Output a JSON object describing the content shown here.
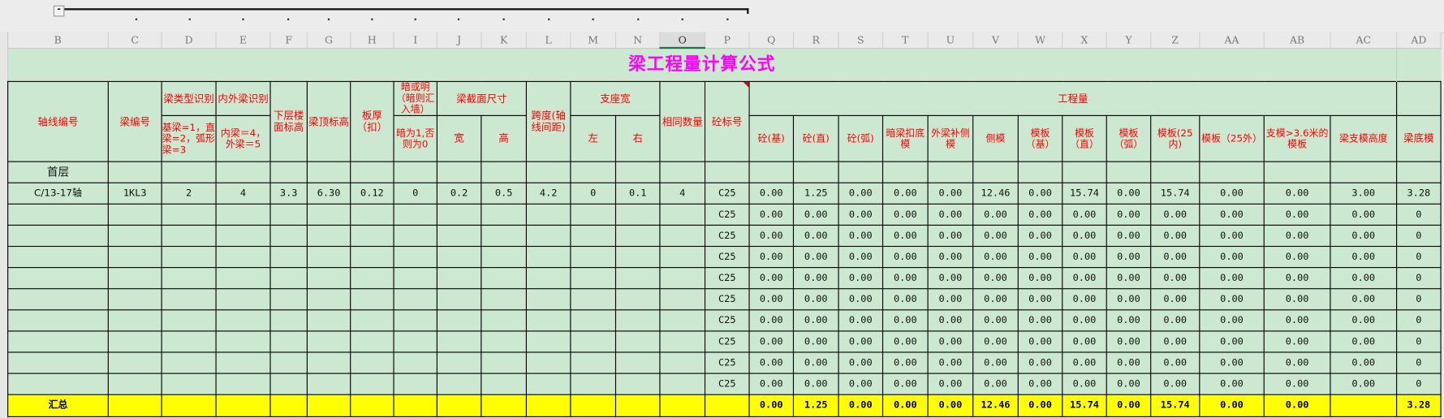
{
  "columns": [
    "B",
    "C",
    "D",
    "E",
    "F",
    "G",
    "H",
    "I",
    "J",
    "K",
    "L",
    "M",
    "N",
    "O",
    "P",
    "Q",
    "R",
    "S",
    "T",
    "U",
    "V",
    "W",
    "X",
    "Y",
    "Z",
    "AA",
    "AB",
    "AC",
    "AD"
  ],
  "selected_column": "O",
  "title": "梁工程量计算公式",
  "headers": {
    "axis": "轴线编号",
    "beam_no": "梁编号",
    "beam_type": "梁类型识别",
    "beam_type_note": "基梁=1，直梁=2，弧形梁=3",
    "inout": "内外梁识别",
    "inout_note": "内梁＝4，外梁＝5",
    "lower_floor": "下层楼面标高",
    "top_elev": "梁顶标高",
    "slab": "板厚（扣）",
    "hidden": "暗或明（暗则汇入墙）",
    "hidden_note": "暗为1,否则为0",
    "section": "梁截面尺寸",
    "width": "宽",
    "height": "高",
    "span": "跨度(轴线间距)",
    "support": "支座宽",
    "left": "左",
    "right": "右",
    "same_qty": "相同数量",
    "grade": "砼标号",
    "quantity": "工程量",
    "q_cols": [
      "砼(基)",
      "砼(直)",
      "砼(弧)",
      "暗梁扣底模",
      "外梁补侧模",
      "侧模",
      "模板（基）",
      "模板（直）",
      "模板（弧）",
      "模板(25内)",
      "模板（25外）",
      "支模>3.6米的模板",
      "梁支模高度"
    ],
    "bottom_form": "梁底模"
  },
  "floor_label": "首层",
  "rows": [
    [
      "C/13-17轴",
      "1KL3",
      "2",
      "4",
      "3.3",
      "6.30",
      "0.12",
      "0",
      "0.2",
      "0.5",
      "4.2",
      "0",
      "0.1",
      "4",
      "C25",
      "0.00",
      "1.25",
      "0.00",
      "0.00",
      "0.00",
      "12.46",
      "0.00",
      "15.74",
      "0.00",
      "15.74",
      "0.00",
      "0.00",
      "3.00",
      "3.28"
    ],
    [
      "",
      "",
      "",
      "",
      "",
      "",
      "",
      "",
      "",
      "",
      "",
      "",
      "",
      "",
      "C25",
      "0.00",
      "0.00",
      "0.00",
      "0.00",
      "0.00",
      "0.00",
      "0.00",
      "0.00",
      "0.00",
      "0.00",
      "0.00",
      "0.00",
      "0.00",
      "0"
    ],
    [
      "",
      "",
      "",
      "",
      "",
      "",
      "",
      "",
      "",
      "",
      "",
      "",
      "",
      "",
      "C25",
      "0.00",
      "0.00",
      "0.00",
      "0.00",
      "0.00",
      "0.00",
      "0.00",
      "0.00",
      "0.00",
      "0.00",
      "0.00",
      "0.00",
      "0.00",
      "0"
    ],
    [
      "",
      "",
      "",
      "",
      "",
      "",
      "",
      "",
      "",
      "",
      "",
      "",
      "",
      "",
      "C25",
      "0.00",
      "0.00",
      "0.00",
      "0.00",
      "0.00",
      "0.00",
      "0.00",
      "0.00",
      "0.00",
      "0.00",
      "0.00",
      "0.00",
      "0.00",
      "0"
    ],
    [
      "",
      "",
      "",
      "",
      "",
      "",
      "",
      "",
      "",
      "",
      "",
      "",
      "",
      "",
      "C25",
      "0.00",
      "0.00",
      "0.00",
      "0.00",
      "0.00",
      "0.00",
      "0.00",
      "0.00",
      "0.00",
      "0.00",
      "0.00",
      "0.00",
      "0.00",
      "0"
    ],
    [
      "",
      "",
      "",
      "",
      "",
      "",
      "",
      "",
      "",
      "",
      "",
      "",
      "",
      "",
      "C25",
      "0.00",
      "0.00",
      "0.00",
      "0.00",
      "0.00",
      "0.00",
      "0.00",
      "0.00",
      "0.00",
      "0.00",
      "0.00",
      "0.00",
      "0.00",
      "0"
    ],
    [
      "",
      "",
      "",
      "",
      "",
      "",
      "",
      "",
      "",
      "",
      "",
      "",
      "",
      "",
      "C25",
      "0.00",
      "0.00",
      "0.00",
      "0.00",
      "0.00",
      "0.00",
      "0.00",
      "0.00",
      "0.00",
      "0.00",
      "0.00",
      "0.00",
      "0.00",
      "0"
    ],
    [
      "",
      "",
      "",
      "",
      "",
      "",
      "",
      "",
      "",
      "",
      "",
      "",
      "",
      "",
      "C25",
      "0.00",
      "0.00",
      "0.00",
      "0.00",
      "0.00",
      "0.00",
      "0.00",
      "0.00",
      "0.00",
      "0.00",
      "0.00",
      "0.00",
      "0.00",
      "0"
    ],
    [
      "",
      "",
      "",
      "",
      "",
      "",
      "",
      "",
      "",
      "",
      "",
      "",
      "",
      "",
      "C25",
      "0.00",
      "0.00",
      "0.00",
      "0.00",
      "0.00",
      "0.00",
      "0.00",
      "0.00",
      "0.00",
      "0.00",
      "0.00",
      "0.00",
      "0.00",
      "0"
    ],
    [
      "",
      "",
      "",
      "",
      "",
      "",
      "",
      "",
      "",
      "",
      "",
      "",
      "",
      "",
      "C25",
      "0.00",
      "0.00",
      "0.00",
      "0.00",
      "0.00",
      "0.00",
      "0.00",
      "0.00",
      "0.00",
      "0.00",
      "0.00",
      "0.00",
      "0.00",
      "0"
    ]
  ],
  "summary": [
    "汇总",
    "",
    "",
    "",
    "",
    "",
    "",
    "",
    "",
    "",
    "",
    "",
    "",
    "",
    "",
    "0.00",
    "1.25",
    "0.00",
    "0.00",
    "0.00",
    "12.46",
    "0.00",
    "15.74",
    "0.00",
    "15.74",
    "0.00",
    "0.00",
    "",
    "3.28"
  ],
  "colors": {
    "grid_bg": "#cde8d0",
    "summary_bg": "#ffff00",
    "title": "#ff00ff",
    "header_text": "#ff0000"
  }
}
